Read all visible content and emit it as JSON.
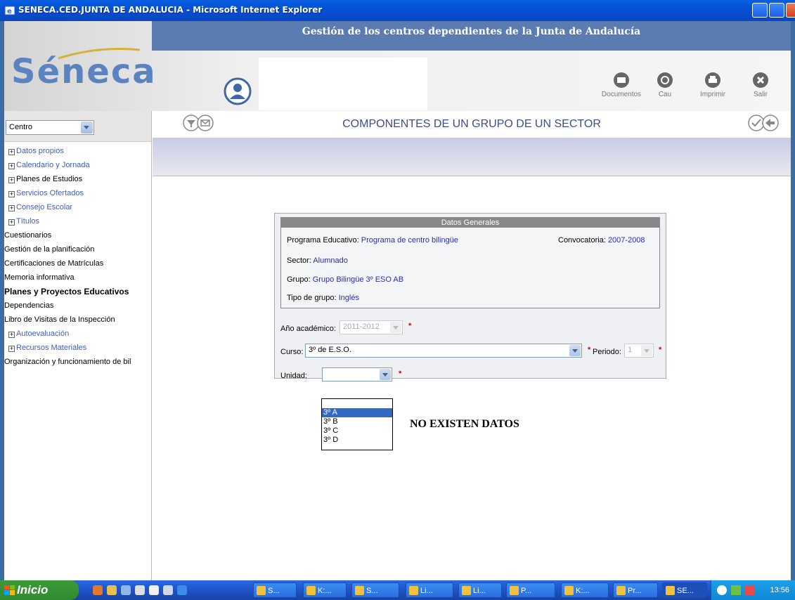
{
  "window": {
    "title": "SENECA.CED.JUNTA DE ANDALUCIA - Microsoft Internet Explorer"
  },
  "header": {
    "subtitle": "Gestión de los centros dependientes de la Junta de Andalucía",
    "logo_text": "Séneca",
    "tools": [
      {
        "label": "Documentos",
        "icon": "documents-icon"
      },
      {
        "label": "Cau",
        "icon": "cau-icon"
      },
      {
        "label": "Imprimir",
        "icon": "print-icon"
      },
      {
        "label": "Salir",
        "icon": "exit-icon"
      }
    ]
  },
  "sidebar": {
    "select_value": "Centro",
    "items": [
      {
        "label": "Datos propios",
        "expander": "+",
        "color": "blue"
      },
      {
        "label": "Calendario y Jornada",
        "expander": "+",
        "color": "blue"
      },
      {
        "label": "Planes de Estudios",
        "expander": "+",
        "color": "black"
      },
      {
        "label": "Servicios Ofertados",
        "expander": "+",
        "color": "blue"
      },
      {
        "label": "Consejo Escolar",
        "expander": "+",
        "color": "blue"
      },
      {
        "label": "Títulos",
        "expander": "+",
        "color": "blue"
      },
      {
        "label": "Cuestionarios",
        "expander": "",
        "color": "black"
      },
      {
        "label": "Gestión de la planificación",
        "expander": "",
        "color": "black"
      },
      {
        "label": "Certificaciones de Matrículas",
        "expander": "",
        "color": "black"
      },
      {
        "label": "Memoria informativa",
        "expander": "",
        "color": "black"
      },
      {
        "label": "Planes y Proyectos Educativos",
        "expander": "",
        "color": "black",
        "bold": true
      },
      {
        "label": "Dependencias",
        "expander": "",
        "color": "black"
      },
      {
        "label": "Libro de Visitas de la Inspección",
        "expander": "",
        "color": "black"
      },
      {
        "label": "Autoevaluación",
        "expander": "+",
        "color": "blue"
      },
      {
        "label": "Recursos Materiales",
        "expander": "+",
        "color": "blue"
      },
      {
        "label": "Organización y funcionamiento de bil",
        "expander": "",
        "color": "black"
      }
    ]
  },
  "main": {
    "title": "COMPONENTES DE UN GRUPO DE UN SECTOR",
    "datos_generales": {
      "header": "Datos Generales",
      "programa_label": "Programa Educativo:",
      "programa_value": "Programa de centro bilingüe",
      "convocatoria_label": "Convocatoria:",
      "convocatoria_value": "2007-2008",
      "sector_label": "Sector:",
      "sector_value": "Alumnado",
      "grupo_label": "Grupo:",
      "grupo_value": "Grupo Bilingüe 3º ESO AB",
      "tipo_label": "Tipo de grupo:",
      "tipo_value": "Inglés"
    },
    "ano_label": "Año académico:",
    "ano_value": "2011-2012",
    "curso_label": "Curso:",
    "curso_value": "3º de E.S.O.",
    "periodo_label": "Periodo:",
    "periodo_value": "1",
    "unidad_label": "Unidad:",
    "unidad_value": "",
    "unidad_options": [
      "",
      "3º A",
      "3º B",
      "3º C",
      "3º D"
    ],
    "no_data": "NO EXISTEN DATOS"
  },
  "taskbar": {
    "start_label": "Inicio",
    "tasks": [
      "S...",
      "K:...",
      "S...",
      "Li...",
      "Li...",
      "P...",
      "K:...",
      "Pr...",
      "SE..."
    ],
    "clock": "13:56"
  }
}
